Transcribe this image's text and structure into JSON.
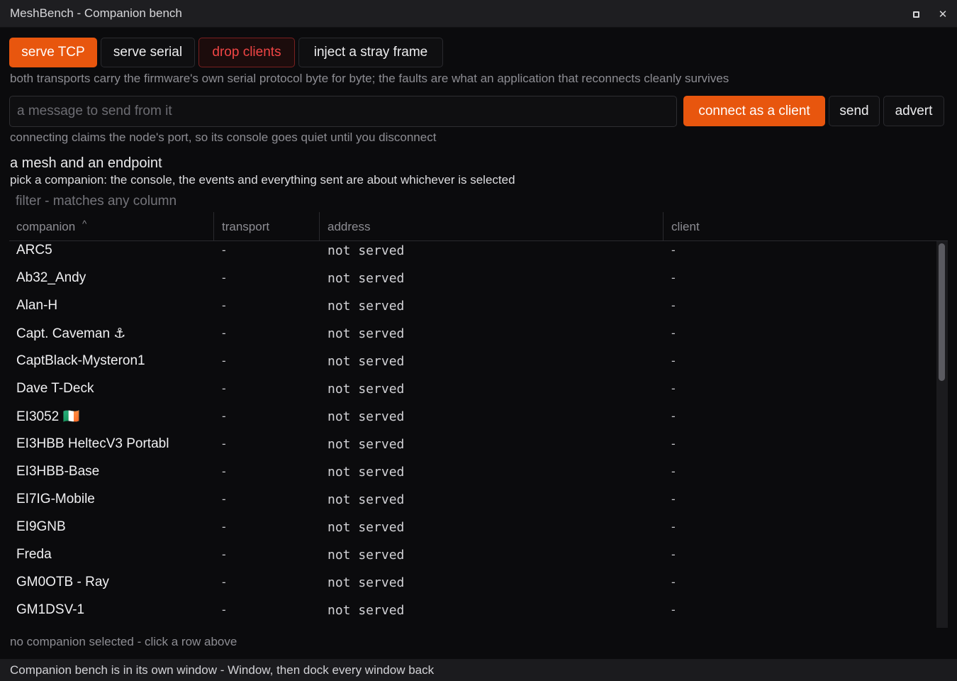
{
  "window": {
    "title": "MeshBench - Companion bench",
    "maximize_icon": "maximize-icon",
    "close_glyph": "✕"
  },
  "toolbar": {
    "serve_tcp": "serve TCP",
    "serve_serial": "serve serial",
    "drop_clients": "drop clients",
    "inject_frame": "inject a stray frame",
    "note": "both transports carry the firmware's own serial protocol byte for byte; the faults are what an application that reconnects cleanly survives"
  },
  "message": {
    "placeholder": "a message to send from it",
    "value": "",
    "connect_label": "connect as a client",
    "send_label": "send",
    "advert_label": "advert",
    "note": "connecting claims the node's port, so its console goes quiet until you disconnect"
  },
  "section": {
    "title": "a mesh and an endpoint",
    "subtitle": "pick a companion: the console, the events and everything sent are about whichever is selected"
  },
  "filter": {
    "placeholder": "filter - matches any column",
    "value": ""
  },
  "table": {
    "columns": {
      "companion": "companion",
      "sort_indicator": "^",
      "transport": "transport",
      "address": "address",
      "client": "client"
    },
    "rows": [
      {
        "companion": "ARC5",
        "transport": "-",
        "address": "not served",
        "client": "-"
      },
      {
        "companion": "Ab32_Andy",
        "transport": "-",
        "address": "not served",
        "client": "-"
      },
      {
        "companion": "Alan-H",
        "transport": "-",
        "address": "not served",
        "client": "-"
      },
      {
        "companion": "Capt. Caveman ⚓",
        "transport": "-",
        "address": "not served",
        "client": "-"
      },
      {
        "companion": "CaptBlack-Mysteron1",
        "transport": "-",
        "address": "not served",
        "client": "-"
      },
      {
        "companion": "Dave T-Deck",
        "transport": "-",
        "address": "not served",
        "client": "-"
      },
      {
        "companion": "EI3052 🇮🇪",
        "transport": "-",
        "address": "not served",
        "client": "-"
      },
      {
        "companion": "EI3HBB HeltecV3 Portabl",
        "transport": "-",
        "address": "not served",
        "client": "-"
      },
      {
        "companion": "EI3HBB-Base",
        "transport": "-",
        "address": "not served",
        "client": "-"
      },
      {
        "companion": "EI7IG-Mobile",
        "transport": "-",
        "address": "not served",
        "client": "-"
      },
      {
        "companion": "EI9GNB",
        "transport": "-",
        "address": "not served",
        "client": "-"
      },
      {
        "companion": "Freda",
        "transport": "-",
        "address": "not served",
        "client": "-"
      },
      {
        "companion": "GM0OTB - Ray",
        "transport": "-",
        "address": "not served",
        "client": "-"
      },
      {
        "companion": "GM1DSV-1",
        "transport": "-",
        "address": "not served",
        "client": "-"
      }
    ]
  },
  "selection_status": "no companion selected - click a row above",
  "status_bar": "Companion bench is in its own window - Window, then dock every window back",
  "colors": {
    "accent": "#e8560e",
    "danger": "#f04545",
    "background": "#0b0b0d"
  }
}
